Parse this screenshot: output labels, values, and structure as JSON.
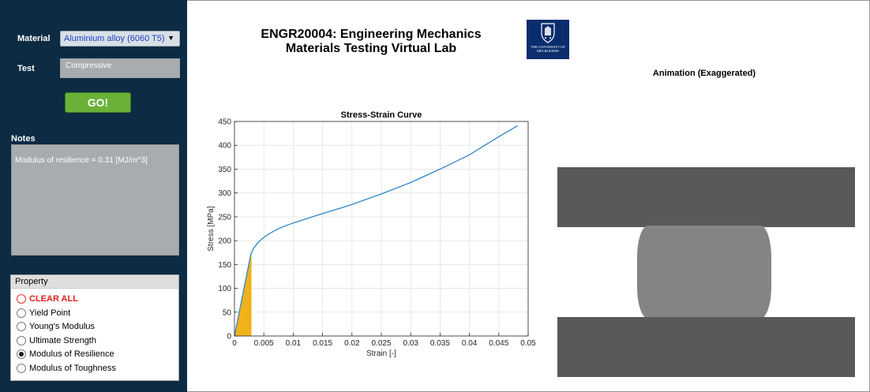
{
  "sidebar": {
    "material_label": "Material",
    "material_value": "Aluminium alloy (6060 T5)",
    "test_label": "Test",
    "test_value": "Compressive",
    "go_label": "GO!",
    "notes_label": "Notes",
    "notes_text": "Modulus of resilience = 0.31 [MJ/m^3]"
  },
  "property": {
    "title": "Property",
    "options": [
      {
        "label": "CLEAR ALL",
        "checked": false,
        "color": "#e02020"
      },
      {
        "label": "Yield Point",
        "checked": false
      },
      {
        "label": "Young's Modulus",
        "checked": false
      },
      {
        "label": "Ultimate Strength",
        "checked": false
      },
      {
        "label": "Modulus of Resilience",
        "checked": true
      },
      {
        "label": "Modulus of Toughness",
        "checked": false
      }
    ]
  },
  "header": {
    "title_line1": "ENGR20004: Engineering Mechanics",
    "title_line2": "Materials Testing Virtual Lab",
    "logo_text": "THE UNIVERSITY OF MELBOURNE"
  },
  "animation": {
    "title": "Animation (Exaggerated)",
    "plate_color": "#595959",
    "specimen_color": "#828486"
  },
  "chart_data": {
    "type": "line",
    "title": "Stress-Strain Curve",
    "xlabel": "Strain [-]",
    "ylabel": "Stress [MPa]",
    "xlim": [
      0,
      0.05
    ],
    "ylim": [
      0,
      450
    ],
    "xticks": [
      "0",
      "0.005",
      "0.01",
      "0.015",
      "0.02",
      "0.025",
      "0.03",
      "0.035",
      "0.04",
      "0.045",
      "0.05"
    ],
    "yticks": [
      "0",
      "50",
      "100",
      "150",
      "200",
      "250",
      "300",
      "350",
      "400",
      "450"
    ],
    "grid": true,
    "line_color": "#2f86c8",
    "fill_color": "#f0b21a",
    "series": [
      {
        "x": [
          0,
          0.0006,
          0.0012,
          0.0018,
          0.0024,
          0.0028,
          0.0033,
          0.004,
          0.005,
          0.006,
          0.007,
          0.008,
          0.01,
          0.012,
          0.015,
          0.018,
          0.02,
          0.025,
          0.03,
          0.035,
          0.04,
          0.045,
          0.0482
        ],
        "y": [
          0,
          37,
          74,
          111,
          148,
          172,
          185,
          196,
          207,
          215,
          222,
          228,
          237,
          245,
          257,
          268,
          276,
          298,
          322,
          350,
          380,
          418,
          441
        ]
      }
    ],
    "shaded_region": {
      "label": "Modulus of Resilience",
      "x": [
        0,
        0.0006,
        0.0012,
        0.0018,
        0.0024,
        0.0029,
        0.0029
      ],
      "y": [
        0,
        37,
        74,
        111,
        148,
        178,
        0
      ]
    }
  }
}
